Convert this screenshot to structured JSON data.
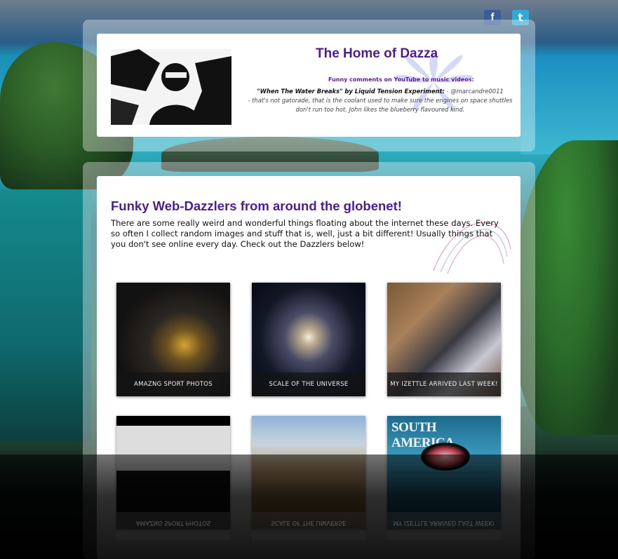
{
  "header": {
    "site_title": "The Home of Dazza",
    "comments_heading": "Funny comments on YouTube to music videos:",
    "quote_song": "\"When The Water Breaks\" by Liquid Tension Experiment:",
    "quote_author": " - @marcandre0011",
    "quote_body": "- that's not gatorade, that is the coolant used to make sure the engines on space shuttles don't run too hot. John likes the blueberry flavoured kind."
  },
  "social": {
    "facebook_glyph": "f",
    "twitter_glyph": "t",
    "facebook_icon": "facebook-icon",
    "twitter_icon": "twitter-icon"
  },
  "main": {
    "section_title": "Funky Web-Dazzlers from around the globenet!",
    "intro_text": "There are some really weird and wonderful things floating about the internet these days. Every so often I collect random images and stuff that is, well, just a bit different! Usually things that you don't see online every day. Check out the Dazzlers below!",
    "tiles": [
      {
        "caption": "AMAZNG SPORT PHOTOS"
      },
      {
        "caption": "SCALE OF THE UNIVERSE"
      },
      {
        "caption": "MY IZETTLE ARRIVED LAST WEEK!"
      },
      {
        "caption": ""
      },
      {
        "caption": ""
      },
      {
        "caption": "",
        "overlay_text": "SOUTH AMERICA"
      }
    ]
  },
  "colors": {
    "title_purple": "#4b1d8e",
    "facebook_blue": "#3b5b99",
    "twitter_blue": "#2fa9d8"
  }
}
